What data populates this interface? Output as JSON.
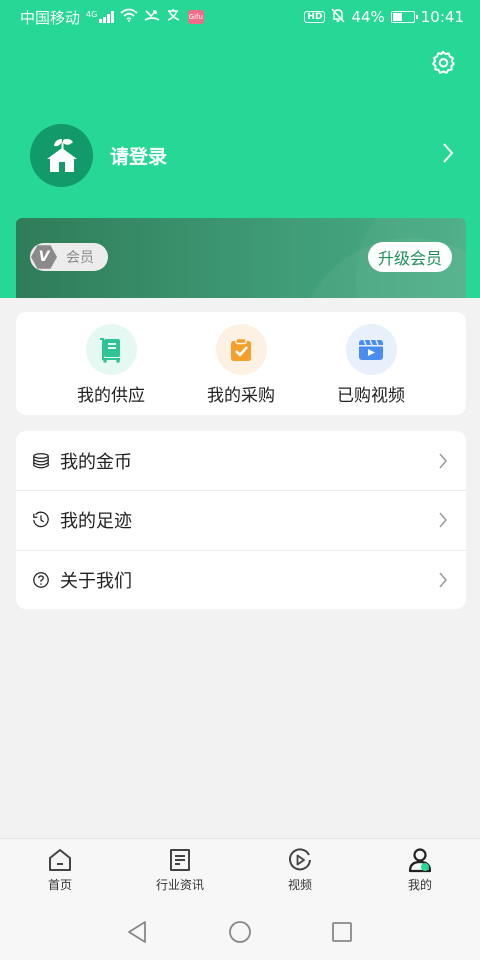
{
  "status_bar": {
    "carrier": "中国移动",
    "network": "4G",
    "hd": "HD",
    "battery": "44%",
    "battery_level": 0.44,
    "time": "10:41",
    "app_badge": "Gifu"
  },
  "header": {
    "settings_icon": "gear-icon",
    "login_text": "请登录",
    "avatar_icon": "house-sprout-icon"
  },
  "member_card": {
    "badge_letter": "V",
    "member_label": "会员",
    "upgrade_label": "升级会员"
  },
  "quick_actions": [
    {
      "label": "我的供应",
      "icon": "supply-cart-icon",
      "color": "#2fc497",
      "bg": "#e6f8f2"
    },
    {
      "label": "我的采购",
      "icon": "purchase-clipboard-icon",
      "color": "#f5a02b",
      "bg": "#fdf1e3"
    },
    {
      "label": "已购视频",
      "icon": "video-player-icon",
      "color": "#4a8cf0",
      "bg": "#e8f0fc"
    }
  ],
  "menu_items": [
    {
      "label": "我的金币",
      "icon": "coins-icon"
    },
    {
      "label": "我的足迹",
      "icon": "history-clock-icon"
    },
    {
      "label": "关于我们",
      "icon": "question-circle-icon"
    }
  ],
  "tabbar": {
    "tabs": [
      {
        "label": "首页",
        "icon": "home-icon"
      },
      {
        "label": "行业资讯",
        "icon": "news-icon"
      },
      {
        "label": "视频",
        "icon": "video-play-icon"
      },
      {
        "label": "我的",
        "icon": "profile-icon",
        "active": true
      }
    ]
  },
  "colors": {
    "brand_green": "#27d796",
    "member_green": "#1e8e5c"
  }
}
